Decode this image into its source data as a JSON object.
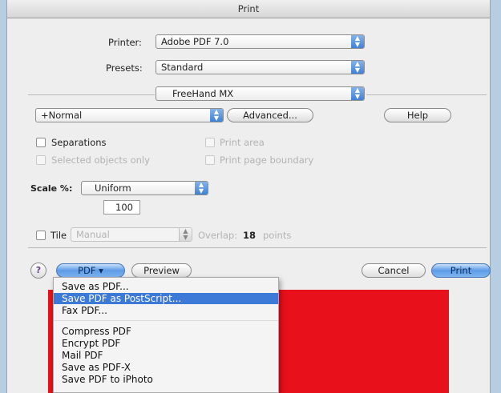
{
  "window": {
    "title": "Print"
  },
  "printer": {
    "label": "Printer:",
    "value": "Adobe PDF 7.0"
  },
  "presets": {
    "label": "Presets:",
    "value": "Standard"
  },
  "panel": {
    "value": "FreeHand MX"
  },
  "setup": {
    "value": "+Normal",
    "advanced_label": "Advanced...",
    "help_label": "Help"
  },
  "options": {
    "separations_label": "Separations",
    "print_area_label": "Print area",
    "selected_objects_label": "Selected objects only",
    "page_boundary_label": "Print page boundary"
  },
  "scale": {
    "label": "Scale %:",
    "mode": "Uniform",
    "value": "100"
  },
  "tile": {
    "label": "Tile",
    "mode": "Manual",
    "overlap_label": "Overlap:",
    "overlap_value": "18",
    "units": "points"
  },
  "bottom": {
    "help_glyph": "?",
    "pdf_label": "PDF ▾",
    "preview_label": "Preview",
    "cancel_label": "Cancel",
    "print_label": "Print"
  },
  "pdf_menu": {
    "items": [
      "Save as PDF...",
      "Save PDF as PostScript...",
      "Fax PDF...",
      "Compress PDF",
      "Encrypt PDF",
      "Mail PDF",
      "Save as PDF-X",
      "Save PDF to iPhoto"
    ],
    "highlighted_index": 1
  },
  "icons": {
    "popup_stepper": "updown-arrows-icon"
  },
  "colors": {
    "accent": "#3d79d6",
    "backdrop": "#e7101b",
    "desktop": "#b7cde2"
  }
}
